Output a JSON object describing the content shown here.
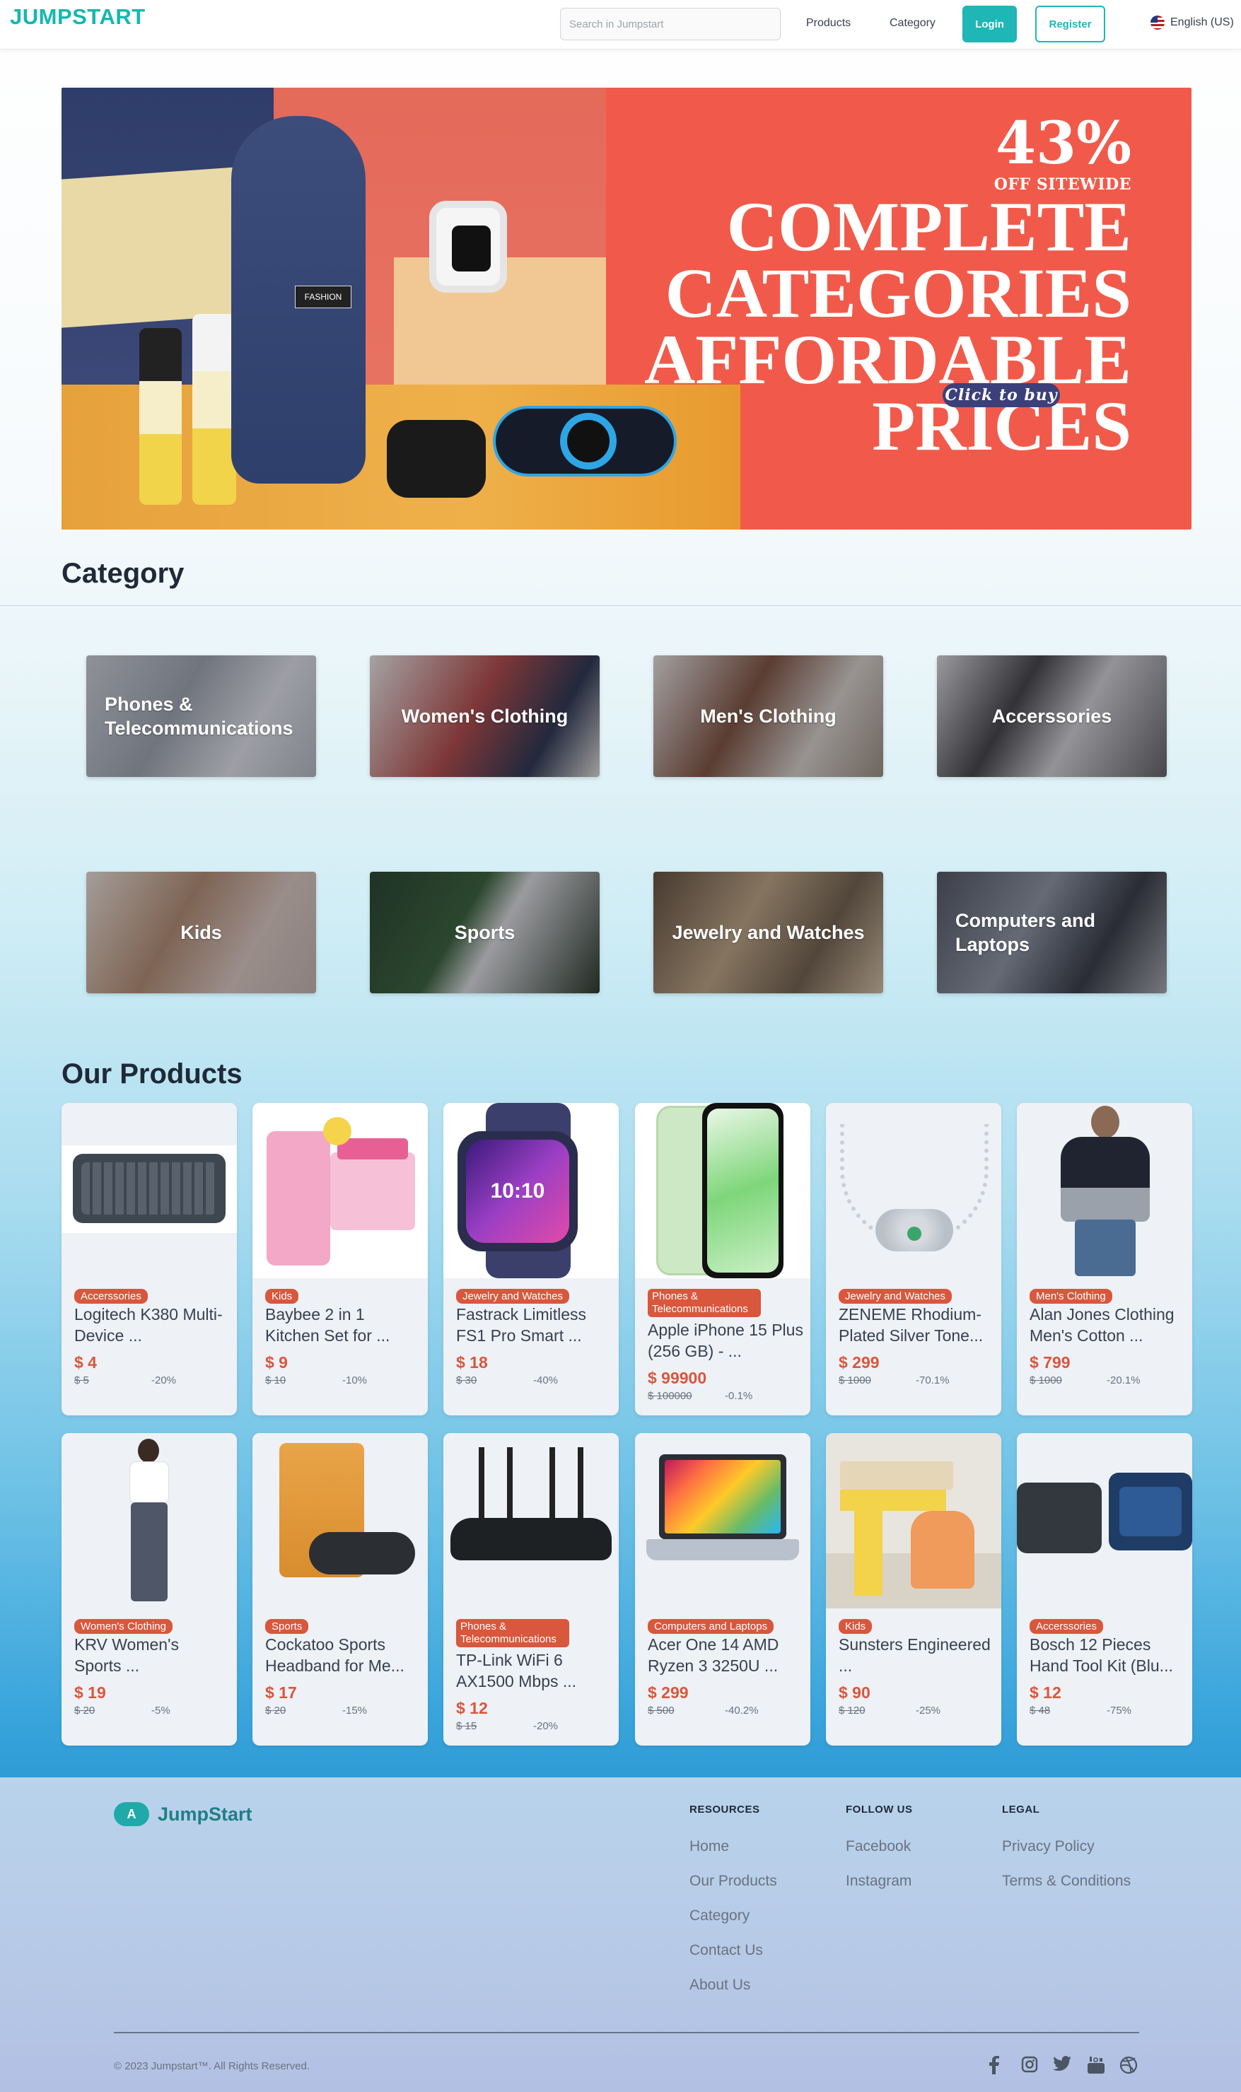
{
  "header": {
    "logo": "JUMPSTART",
    "search_placeholder": "Search in Jumpstart",
    "nav": [
      "Products",
      "Category"
    ],
    "login": "Login",
    "register": "Register",
    "language": "English (US)"
  },
  "banner": {
    "percent": "43%",
    "sub": "OFF SITEWIDE",
    "headline": [
      "COMPLETE",
      "CATEGORIES",
      "AFFORDABLE",
      "PRICES"
    ],
    "cta": "Click to buy",
    "bag_tag": "FASHION"
  },
  "category_section": {
    "title": "Category",
    "items": [
      "Phones & Telecommunications",
      "Women's Clothing",
      "Men's Clothing",
      "Accerssories",
      "Kids",
      "Sports",
      "Jewelry and Watches",
      "Computers and Laptops"
    ]
  },
  "products_section": {
    "title": "Our Products",
    "items": [
      {
        "category": "Accerssories",
        "title": "Logitech K380 Multi-Device ...",
        "price": "$ 4",
        "old_price": "$ 5",
        "discount": "-20%"
      },
      {
        "category": "Kids",
        "title": "Baybee 2 in 1 Kitchen Set for ...",
        "price": "$ 9",
        "old_price": "$ 10",
        "discount": "-10%"
      },
      {
        "category": "Jewelry and Watches",
        "title": "Fastrack Limitless FS1 Pro Smart ...",
        "price": "$ 18",
        "old_price": "$ 30",
        "discount": "-40%"
      },
      {
        "category": "Phones & Telecommunications",
        "title": "Apple iPhone 15 Plus (256 GB) - ...",
        "price": "$ 99900",
        "old_price": "$ 100000",
        "discount": "-0.1%"
      },
      {
        "category": "Jewelry and Watches",
        "title": "ZENEME Rhodium-Plated Silver Tone...",
        "price": "$ 299",
        "old_price": "$ 1000",
        "discount": "-70.1%"
      },
      {
        "category": "Men's Clothing",
        "title": "Alan Jones Clothing Men's Cotton ...",
        "price": "$ 799",
        "old_price": "$ 1000",
        "discount": "-20.1%"
      },
      {
        "category": "Women's Clothing",
        "title": "KRV Women's Sports ...",
        "price": "$ 19",
        "old_price": "$ 20",
        "discount": "-5%"
      },
      {
        "category": "Sports",
        "title": "Cockatoo Sports Headband for Me...",
        "price": "$ 17",
        "old_price": "$ 20",
        "discount": "-15%"
      },
      {
        "category": "Phones & Telecommunications",
        "title": "TP-Link WiFi 6 AX1500 Mbps ...",
        "price": "$ 12",
        "old_price": "$ 15",
        "discount": "-20%"
      },
      {
        "category": "Computers and Laptops",
        "title": "Acer One 14 AMD Ryzen 3 3250U ...",
        "price": "$ 299",
        "old_price": "$ 500",
        "discount": "-40.2%"
      },
      {
        "category": "Kids",
        "title": "Sunsters Engineered ...",
        "price": "$ 90",
        "old_price": "$ 120",
        "discount": "-25%"
      },
      {
        "category": "Accerssories",
        "title": "Bosch 12 Pieces Hand Tool Kit (Blu...",
        "price": "$ 12",
        "old_price": "$ 48",
        "discount": "-75%"
      }
    ]
  },
  "footer": {
    "brand": "JumpStart",
    "columns": [
      {
        "title": "RESOURCES",
        "links": [
          "Home",
          "Our Products",
          "Category",
          "Contact Us",
          "About Us"
        ]
      },
      {
        "title": "FOLLOW US",
        "links": [
          "Facebook",
          "Instagram"
        ]
      },
      {
        "title": "LEGAL",
        "links": [
          "Privacy Policy",
          "Terms & Conditions"
        ]
      }
    ],
    "copyright": "© 2023 Jumpstart™. All Rights Reserved.",
    "social_icons": [
      "facebook-icon",
      "instagram-icon",
      "twitter-icon",
      "youtube-icon",
      "dribbble-icon"
    ]
  }
}
